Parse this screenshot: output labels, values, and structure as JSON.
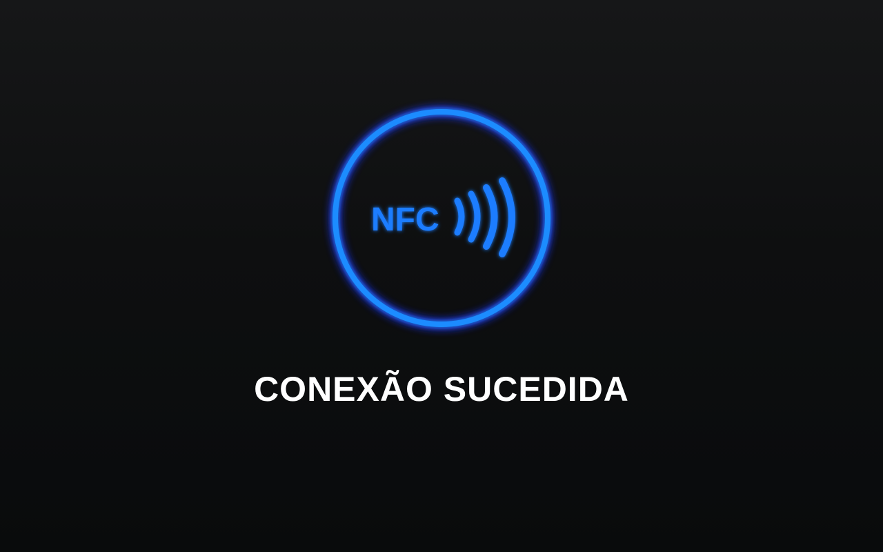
{
  "screen": {
    "icon": "nfc-icon",
    "icon_label": "NFC",
    "status_message": "CONEXÃO SUCEDIDA"
  },
  "colors": {
    "background": "#0c0d0e",
    "ring": "#1a8cff",
    "glow": "#1f3cff",
    "icon_text": "#1a7dff",
    "message": "#ffffff"
  }
}
